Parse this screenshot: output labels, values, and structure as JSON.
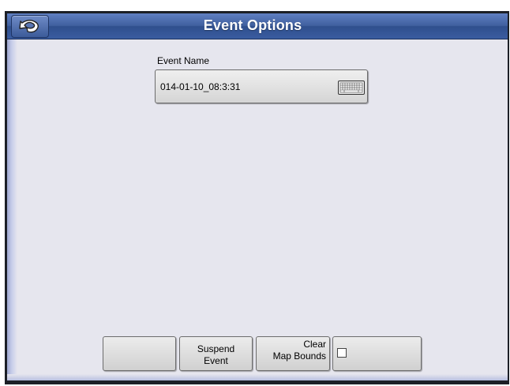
{
  "header": {
    "title": "Event Options",
    "back_icon": "back-arrow-icon"
  },
  "event_name": {
    "label": "Event Name",
    "value": "014-01-10_08:3:31",
    "keyboard_icon": "keyboard-icon"
  },
  "buttons": {
    "blank_1": "",
    "suspend_line1": "Suspend",
    "suspend_line2": "Event",
    "clear_line1": "Clear",
    "clear_line2": "Map Bounds",
    "checkbox_checked": false
  },
  "colors": {
    "titlebar": "#40609f",
    "background": "#e6e6ee",
    "button": "#dcdcdc"
  }
}
